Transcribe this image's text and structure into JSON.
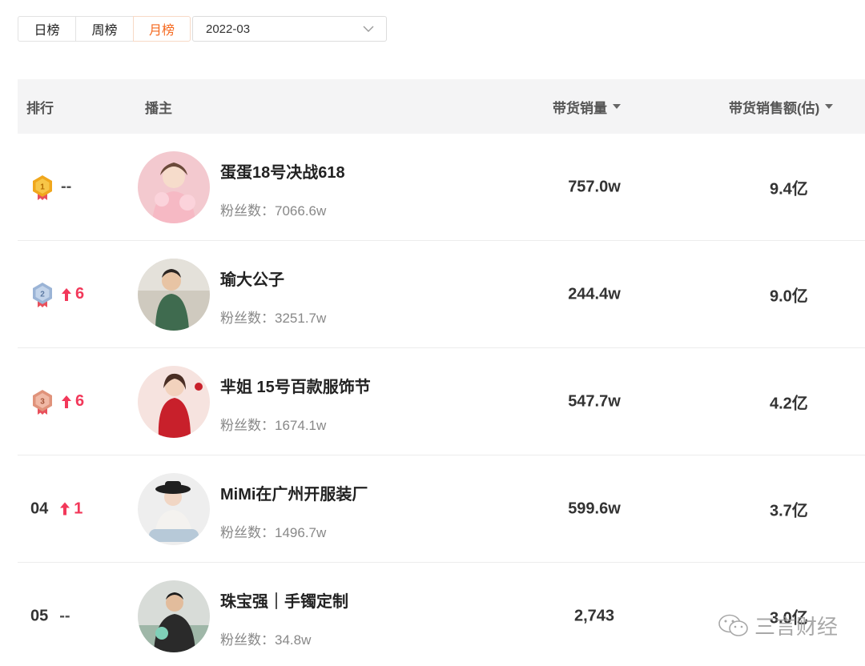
{
  "tabs": [
    "日榜",
    "周榜",
    "月榜"
  ],
  "active_tab": "月榜",
  "month_select": {
    "value": "2022-03"
  },
  "table": {
    "headers": {
      "rank": "排行",
      "anchor": "播主",
      "sales": "带货销量",
      "amount": "带货销售额(估)"
    },
    "rows": [
      {
        "rank": "",
        "medal": "1",
        "medal_color": "#f0a71c",
        "change": "--",
        "change_dir": "none",
        "name": "蛋蛋18号决战618",
        "fans": "粉丝数：7066.6w",
        "sales": "757.0w",
        "amount": "9.4亿"
      },
      {
        "rank": "",
        "medal": "2",
        "medal_color": "#9bb4d6",
        "change": "6",
        "change_dir": "up",
        "name": "瑜大公子",
        "fans": "粉丝数：3251.7w",
        "sales": "244.4w",
        "amount": "9.0亿"
      },
      {
        "rank": "",
        "medal": "3",
        "medal_color": "#e0937b",
        "change": "6",
        "change_dir": "up",
        "name": "芈姐 15号百款服饰节",
        "fans": "粉丝数：1674.1w",
        "sales": "547.7w",
        "amount": "4.2亿"
      },
      {
        "rank": "04",
        "medal": "",
        "medal_color": "",
        "change": "1",
        "change_dir": "up",
        "name": "MiMi在广州开服装厂",
        "fans": "粉丝数：1496.7w",
        "sales": "599.6w",
        "amount": "3.7亿"
      },
      {
        "rank": "05",
        "medal": "",
        "medal_color": "",
        "change": "--",
        "change_dir": "none",
        "name": "珠宝强｜手镯定制",
        "fans": "粉丝数：34.8w",
        "sales": "2,743",
        "amount": "3.0亿"
      }
    ]
  },
  "watermark": {
    "text": "三言财经"
  },
  "colors": {
    "accent": "#f5691f",
    "up": "#f2385a",
    "header_bg": "#f4f4f5"
  }
}
